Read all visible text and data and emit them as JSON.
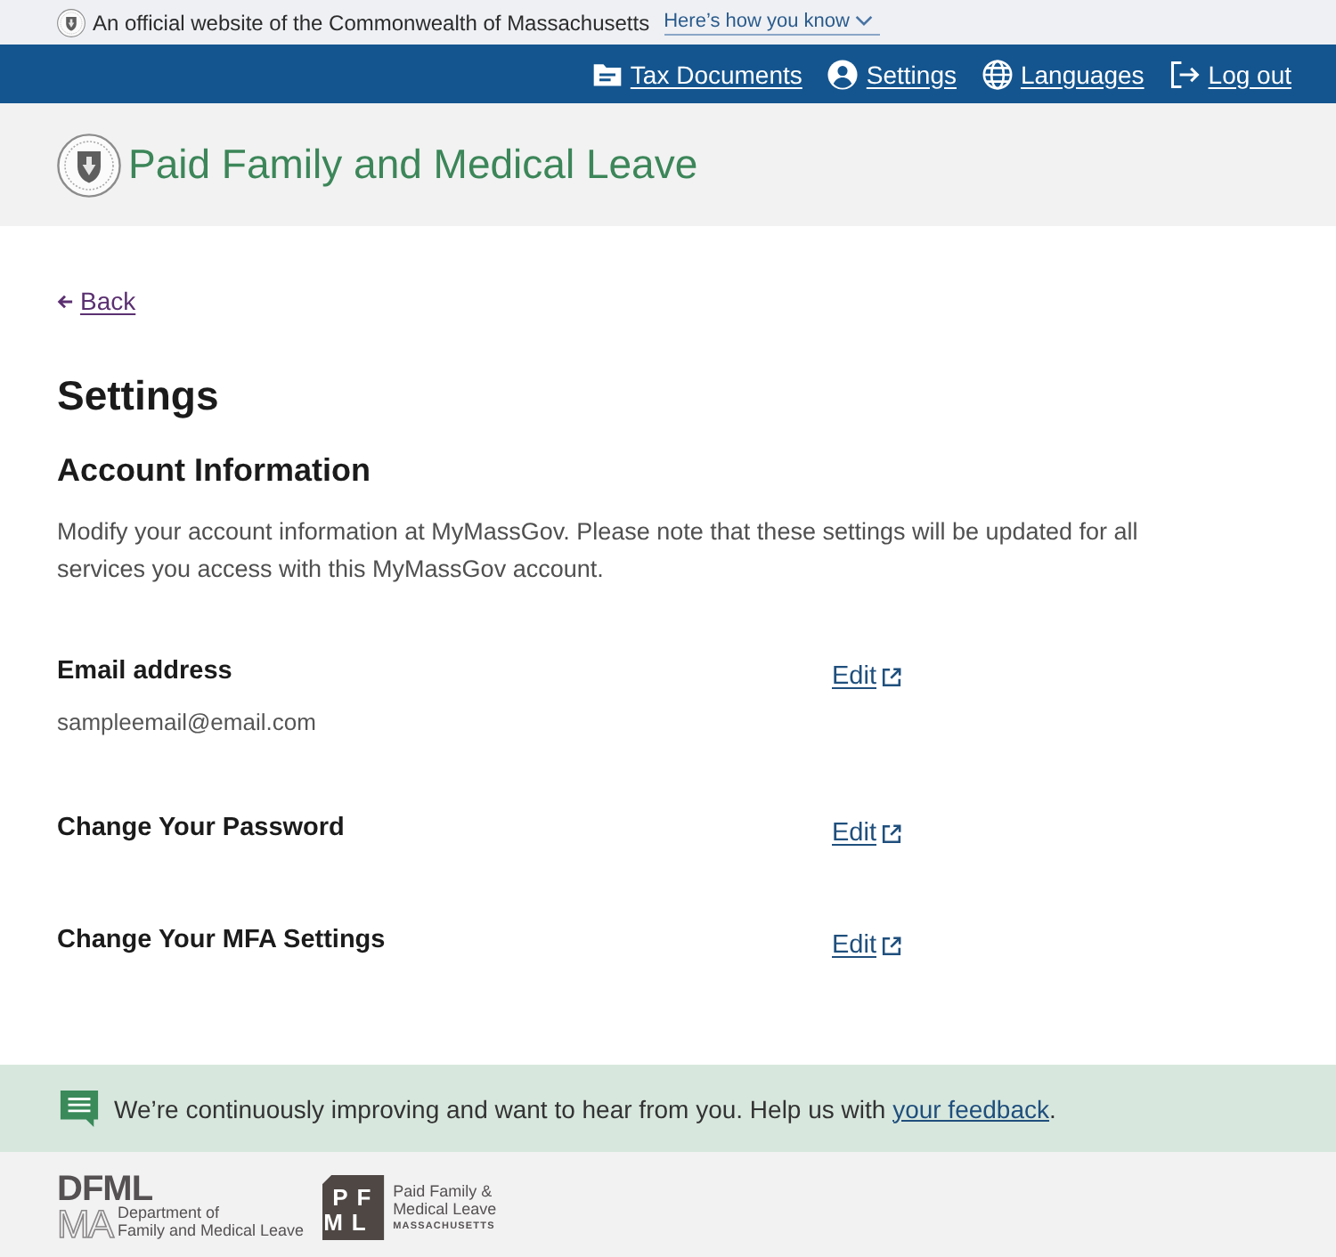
{
  "official_banner": {
    "text": "An official website of the Commonwealth of Massachusetts",
    "link": "Here’s how you know"
  },
  "top_nav": {
    "items": [
      {
        "label": "Tax Documents"
      },
      {
        "label": "Settings"
      },
      {
        "label": "Languages"
      },
      {
        "label": "Log out"
      }
    ]
  },
  "header": {
    "title": "Paid Family and Medical Leave"
  },
  "back_link": {
    "label": "Back"
  },
  "page_title": "Settings",
  "account_section": {
    "title": "Account Information",
    "description": "Modify your account information at MyMassGov. Please note that these settings will be updated for all services you access with this MyMassGov account.",
    "rows": [
      {
        "label": "Email address",
        "value": "sampleemail@email.com",
        "action": "Edit"
      },
      {
        "label": "Change Your Password",
        "action": "Edit"
      },
      {
        "label": "Change Your MFA Settings",
        "action": "Edit"
      }
    ]
  },
  "feedback": {
    "text": "We’re continuously improving and want to hear from you. Help us with ",
    "link": "your feedback",
    "end": "."
  },
  "footer": {
    "logos": [
      {
        "kind": "dfml",
        "wordmark": [
          "DFML",
          "MA"
        ],
        "caption": [
          "Department of",
          "Family and Medical Leave"
        ]
      },
      {
        "kind": "pfml",
        "tile": [
          "PF",
          "ML"
        ],
        "caption": [
          "Paid Family &",
          "Medical Leave"
        ],
        "state": "MASSACHUSETTS"
      }
    ]
  }
}
